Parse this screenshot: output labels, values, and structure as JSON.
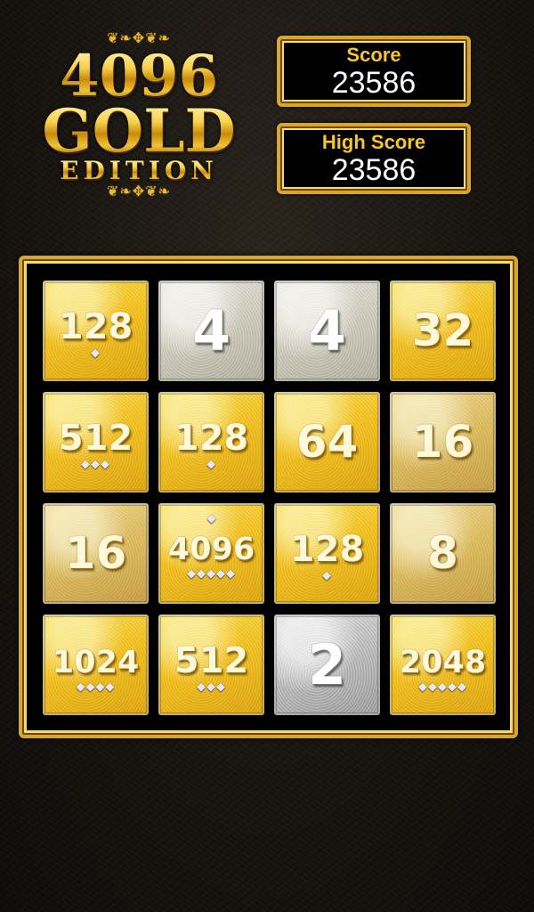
{
  "logo": {
    "line1": "4096",
    "line2": "GOLD",
    "line3": "EDITION",
    "flourish": "❦❧✥❦❧"
  },
  "score": {
    "label": "Score",
    "value": "23586"
  },
  "high_score": {
    "label": "High Score",
    "value": "23586"
  },
  "board": {
    "tiles": [
      {
        "value": "128",
        "gems": "◆"
      },
      {
        "value": "4",
        "gems": ""
      },
      {
        "value": "4",
        "gems": ""
      },
      {
        "value": "32",
        "gems": ""
      },
      {
        "value": "512",
        "gems": "◆◆◆"
      },
      {
        "value": "128",
        "gems": "◆"
      },
      {
        "value": "64",
        "gems": ""
      },
      {
        "value": "16",
        "gems": ""
      },
      {
        "value": "16",
        "gems": ""
      },
      {
        "value": "4096",
        "gems": "◆◆◆◆◆",
        "gem_top": "◆"
      },
      {
        "value": "128",
        "gems": "◆"
      },
      {
        "value": "8",
        "gems": ""
      },
      {
        "value": "1024",
        "gems": "◆◆◆◆"
      },
      {
        "value": "512",
        "gems": "◆◆◆"
      },
      {
        "value": "2",
        "gems": ""
      },
      {
        "value": "2048",
        "gems": "◆◆◆◆◆"
      }
    ]
  },
  "colors": {
    "gold_accent": "#f4c52d",
    "board_border": "#d8a62a",
    "background": "#17130e"
  }
}
